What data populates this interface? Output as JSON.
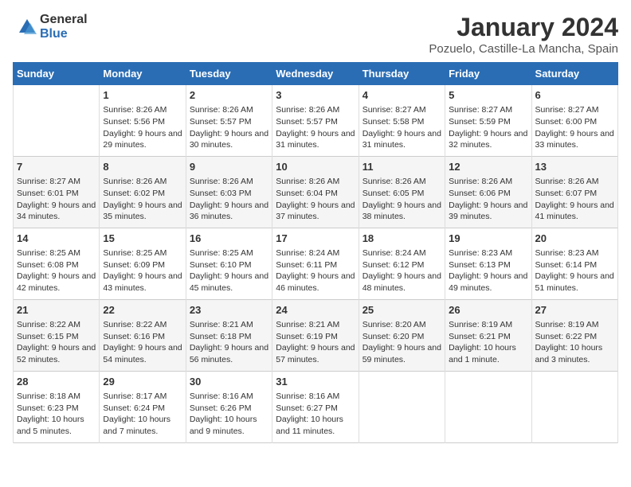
{
  "logo": {
    "general": "General",
    "blue": "Blue"
  },
  "title": "January 2024",
  "location": "Pozuelo, Castille-La Mancha, Spain",
  "weekdays": [
    "Sunday",
    "Monday",
    "Tuesday",
    "Wednesday",
    "Thursday",
    "Friday",
    "Saturday"
  ],
  "weeks": [
    [
      {
        "day": null
      },
      {
        "day": 1,
        "sunrise": "8:26 AM",
        "sunset": "5:56 PM",
        "daylight": "9 hours and 29 minutes."
      },
      {
        "day": 2,
        "sunrise": "8:26 AM",
        "sunset": "5:57 PM",
        "daylight": "9 hours and 30 minutes."
      },
      {
        "day": 3,
        "sunrise": "8:26 AM",
        "sunset": "5:57 PM",
        "daylight": "9 hours and 31 minutes."
      },
      {
        "day": 4,
        "sunrise": "8:27 AM",
        "sunset": "5:58 PM",
        "daylight": "9 hours and 31 minutes."
      },
      {
        "day": 5,
        "sunrise": "8:27 AM",
        "sunset": "5:59 PM",
        "daylight": "9 hours and 32 minutes."
      },
      {
        "day": 6,
        "sunrise": "8:27 AM",
        "sunset": "6:00 PM",
        "daylight": "9 hours and 33 minutes."
      }
    ],
    [
      {
        "day": 7,
        "sunrise": "8:27 AM",
        "sunset": "6:01 PM",
        "daylight": "9 hours and 34 minutes."
      },
      {
        "day": 8,
        "sunrise": "8:26 AM",
        "sunset": "6:02 PM",
        "daylight": "9 hours and 35 minutes."
      },
      {
        "day": 9,
        "sunrise": "8:26 AM",
        "sunset": "6:03 PM",
        "daylight": "9 hours and 36 minutes."
      },
      {
        "day": 10,
        "sunrise": "8:26 AM",
        "sunset": "6:04 PM",
        "daylight": "9 hours and 37 minutes."
      },
      {
        "day": 11,
        "sunrise": "8:26 AM",
        "sunset": "6:05 PM",
        "daylight": "9 hours and 38 minutes."
      },
      {
        "day": 12,
        "sunrise": "8:26 AM",
        "sunset": "6:06 PM",
        "daylight": "9 hours and 39 minutes."
      },
      {
        "day": 13,
        "sunrise": "8:26 AM",
        "sunset": "6:07 PM",
        "daylight": "9 hours and 41 minutes."
      }
    ],
    [
      {
        "day": 14,
        "sunrise": "8:25 AM",
        "sunset": "6:08 PM",
        "daylight": "9 hours and 42 minutes."
      },
      {
        "day": 15,
        "sunrise": "8:25 AM",
        "sunset": "6:09 PM",
        "daylight": "9 hours and 43 minutes."
      },
      {
        "day": 16,
        "sunrise": "8:25 AM",
        "sunset": "6:10 PM",
        "daylight": "9 hours and 45 minutes."
      },
      {
        "day": 17,
        "sunrise": "8:24 AM",
        "sunset": "6:11 PM",
        "daylight": "9 hours and 46 minutes."
      },
      {
        "day": 18,
        "sunrise": "8:24 AM",
        "sunset": "6:12 PM",
        "daylight": "9 hours and 48 minutes."
      },
      {
        "day": 19,
        "sunrise": "8:23 AM",
        "sunset": "6:13 PM",
        "daylight": "9 hours and 49 minutes."
      },
      {
        "day": 20,
        "sunrise": "8:23 AM",
        "sunset": "6:14 PM",
        "daylight": "9 hours and 51 minutes."
      }
    ],
    [
      {
        "day": 21,
        "sunrise": "8:22 AM",
        "sunset": "6:15 PM",
        "daylight": "9 hours and 52 minutes."
      },
      {
        "day": 22,
        "sunrise": "8:22 AM",
        "sunset": "6:16 PM",
        "daylight": "9 hours and 54 minutes."
      },
      {
        "day": 23,
        "sunrise": "8:21 AM",
        "sunset": "6:18 PM",
        "daylight": "9 hours and 56 minutes."
      },
      {
        "day": 24,
        "sunrise": "8:21 AM",
        "sunset": "6:19 PM",
        "daylight": "9 hours and 57 minutes."
      },
      {
        "day": 25,
        "sunrise": "8:20 AM",
        "sunset": "6:20 PM",
        "daylight": "9 hours and 59 minutes."
      },
      {
        "day": 26,
        "sunrise": "8:19 AM",
        "sunset": "6:21 PM",
        "daylight": "10 hours and 1 minute."
      },
      {
        "day": 27,
        "sunrise": "8:19 AM",
        "sunset": "6:22 PM",
        "daylight": "10 hours and 3 minutes."
      }
    ],
    [
      {
        "day": 28,
        "sunrise": "8:18 AM",
        "sunset": "6:23 PM",
        "daylight": "10 hours and 5 minutes."
      },
      {
        "day": 29,
        "sunrise": "8:17 AM",
        "sunset": "6:24 PM",
        "daylight": "10 hours and 7 minutes."
      },
      {
        "day": 30,
        "sunrise": "8:16 AM",
        "sunset": "6:26 PM",
        "daylight": "10 hours and 9 minutes."
      },
      {
        "day": 31,
        "sunrise": "8:16 AM",
        "sunset": "6:27 PM",
        "daylight": "10 hours and 11 minutes."
      },
      {
        "day": null
      },
      {
        "day": null
      },
      {
        "day": null
      }
    ]
  ]
}
